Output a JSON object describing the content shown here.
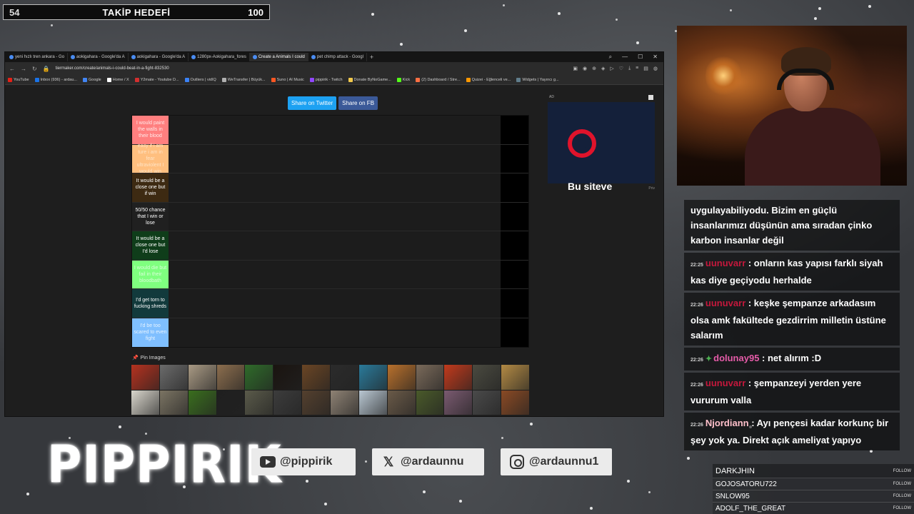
{
  "goal": {
    "current": "54",
    "label": "TAKİP HEDEFİ",
    "max": "100"
  },
  "browser": {
    "tabs": [
      "yeni hızlı tren ankara - Go",
      "aokigahara - Google'da A",
      "aokigahara - Google'da A",
      "1280px-Aokigahara_fores",
      "Create a Animals I could",
      "pet chimp attack - Googl"
    ],
    "url": "tiermaker.com/create/animals-i-could-beat-in-a-fight-832530",
    "bookmarks": [
      "YouTube",
      "Inbox (936) - ardau...",
      "Google",
      "Home / X",
      "Y2mate - Youtube D...",
      "Outliers | vidIQ",
      "WeTransfer | Büyük...",
      "Suno | AI Music",
      "pippirik - Twitch",
      "Donate ByNoGame...",
      "Kick",
      "(2) Dashboard / Stre...",
      "Quizei - Eğlenceli ve...",
      "Widgets | Yayıncı g..."
    ],
    "bookmark_colors": [
      "#e62117",
      "#1a73e8",
      "#4285f4",
      "#ffffff",
      "#d32f2f",
      "#3b82f6",
      "#b0b0b0",
      "#ff5722",
      "#9146ff",
      "#f2c94c",
      "#53fc18",
      "#ff7043",
      "#ff9800",
      "#607d8b"
    ]
  },
  "tiermaker": {
    "share_twitter": "Share on Twitter",
    "share_fb": "Share on FB",
    "tiers": [
      {
        "label": "I would paint the walls in their blood",
        "color": "#ff7f7f",
        "text_color": "#ffe8e8"
      },
      {
        "label": "easy if i am ture i am in fear ultraviolent I would win",
        "color": "#ffbf7f",
        "text_color": "#ffe3c4"
      },
      {
        "label": "It would be a close one but if win",
        "color": "#3d2a12",
        "text_color": "#ffffff"
      },
      {
        "label": "50/50 chance that I win or lose",
        "color": "#202020",
        "text_color": "#ffffff"
      },
      {
        "label": "It would be a close one but I'd lose",
        "color": "#0f3d1a",
        "text_color": "#ffffff"
      },
      {
        "label": "I would die but fail in their bloodbath",
        "color": "#7fff7f",
        "text_color": "#d7ffd7"
      },
      {
        "label": "I'd get torn to fucking shreds",
        "color": "#123a3c",
        "text_color": "#ffffff"
      },
      {
        "label": "I'd be too scared to even fight",
        "color": "#7fbfff",
        "text_color": "#e6f3ff"
      }
    ],
    "pin_label": "Pin Images",
    "image_colors": [
      "#b5321f",
      "#6b6b6b",
      "#a99a84",
      "#8c6e4e",
      "#2f6b2a",
      "#1a1410",
      "#6a4524",
      "#2b2b2b",
      "#2a7a9a",
      "#b8702c",
      "#7a6a5a",
      "#c23a1c",
      "#4a4a40",
      "#b38a44",
      "#d9d6cc",
      "#7b7463",
      "#3a6e1e",
      "#1f1f1f",
      "#5a5a4a",
      "#3c3c3c",
      "#54402e",
      "#8e8274",
      "#b9c7d2",
      "#6a5a48",
      "#4a5a2a",
      "#7a5a70",
      "#4a4a4a",
      "#8a4a24"
    ]
  },
  "ad": {
    "tag": "AD",
    "title": "Bu siteve",
    "privacy": "Priv"
  },
  "chat": [
    {
      "time": "",
      "user": "",
      "user_class": "",
      "badge": "",
      "text": "uygulayabiliyodu. Bizim en güçlü insanlarımızı düşünün ama sıradan çinko karbon insanlar değil"
    },
    {
      "time": "22:25",
      "user": "uunuvarr",
      "user_class": "user",
      "badge": "",
      "text": " : onların kas yapısı farklı siyah kas diye geçiyodu herhalde"
    },
    {
      "time": "22:26",
      "user": "uunuvarr",
      "user_class": "user",
      "badge": "",
      "text": " : keşke şempanze arkadasım olsa amk fakültede gezdirrim milletin üstüne salarım"
    },
    {
      "time": "22:26",
      "user": "dolunay95",
      "user_class": "user green",
      "badge": "✦",
      "text": " : net alırım :D"
    },
    {
      "time": "22:26",
      "user": "uunuvarr",
      "user_class": "user",
      "badge": "",
      "text": " : şempanzeyi yerden yere vururum valla"
    },
    {
      "time": "22:26",
      "user": "Njordiann",
      "user_class": "user pink",
      "badge": "",
      "text": " : Ayı pençesi kadar korkunç bir şey yok ya. Direkt açık ameliyat yapıyo"
    }
  ],
  "branding": {
    "logo": "PIPPIRIK",
    "youtube": "@pippirik",
    "x": "@ardaunnu",
    "instagram": "@ardaunnu1"
  },
  "followers": {
    "header": "DARKJHIN",
    "tag": "FOLLOW",
    "list": [
      "GOJOSATORU722",
      "SNLOW95",
      "ADOLF_THE_GREAT"
    ]
  }
}
